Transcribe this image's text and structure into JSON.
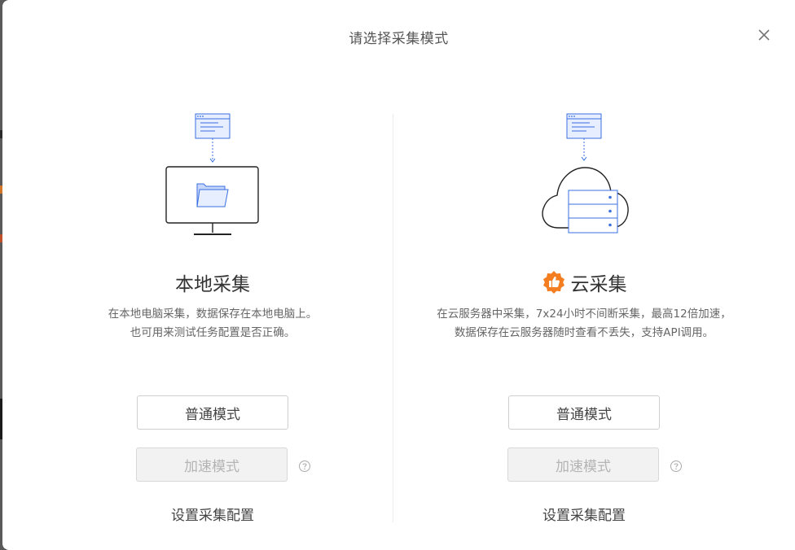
{
  "dialog": {
    "title": "请选择采集模式",
    "close_icon": "close-icon"
  },
  "local": {
    "illustration": "local-computer-illustration",
    "title": "本地采集",
    "desc_line1": "在本地电脑采集，数据保存在本地电脑上。",
    "desc_line2": "也可用来测试任务配置是否正确。",
    "normal_label": "普通模式",
    "speed_label": "加速模式",
    "help_icon": "question-icon",
    "config_label": "设置采集配置"
  },
  "cloud": {
    "illustration": "cloud-server-illustration",
    "badge_icon": "thumbs-up-badge-icon",
    "title": "云采集",
    "desc_line1": "在云服务器中采集，7x24小时不间断采集，最高12倍加速，",
    "desc_line2": "数据保存在云服务器随时查看不丢失，支持API调用。",
    "normal_label": "普通模式",
    "speed_label": "加速模式",
    "help_icon": "question-icon",
    "config_label": "设置采集配置"
  },
  "colors": {
    "accent_blue": "#3a6fe0",
    "badge_orange": "#f47d20",
    "disabled_bg": "#f2f2f2"
  }
}
